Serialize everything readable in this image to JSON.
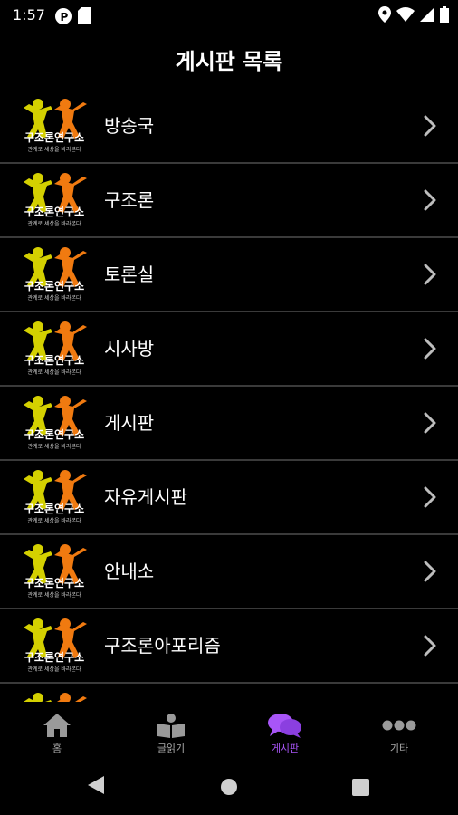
{
  "status": {
    "time": "1:57"
  },
  "header": {
    "title": "게시판 목록"
  },
  "logo": {
    "text": "구조론연구소",
    "tagline": "관계로 세상을 바라본다"
  },
  "boards": [
    {
      "label": "방송국"
    },
    {
      "label": "구조론"
    },
    {
      "label": "토론실"
    },
    {
      "label": "시사방"
    },
    {
      "label": "게시판"
    },
    {
      "label": "자유게시판"
    },
    {
      "label": "안내소"
    },
    {
      "label": "구조론아포리즘"
    }
  ],
  "tabs": [
    {
      "label": "홈",
      "icon": "home-icon"
    },
    {
      "label": "글읽기",
      "icon": "reader-icon"
    },
    {
      "label": "게시판",
      "icon": "chat-bubbles-icon",
      "active": true
    },
    {
      "label": "기타",
      "icon": "more-icon"
    }
  ],
  "colors": {
    "accent": "#a855f7",
    "divider": "#3a3a3a",
    "logo_yellow": "#d4d000",
    "logo_orange": "#f07a10"
  }
}
